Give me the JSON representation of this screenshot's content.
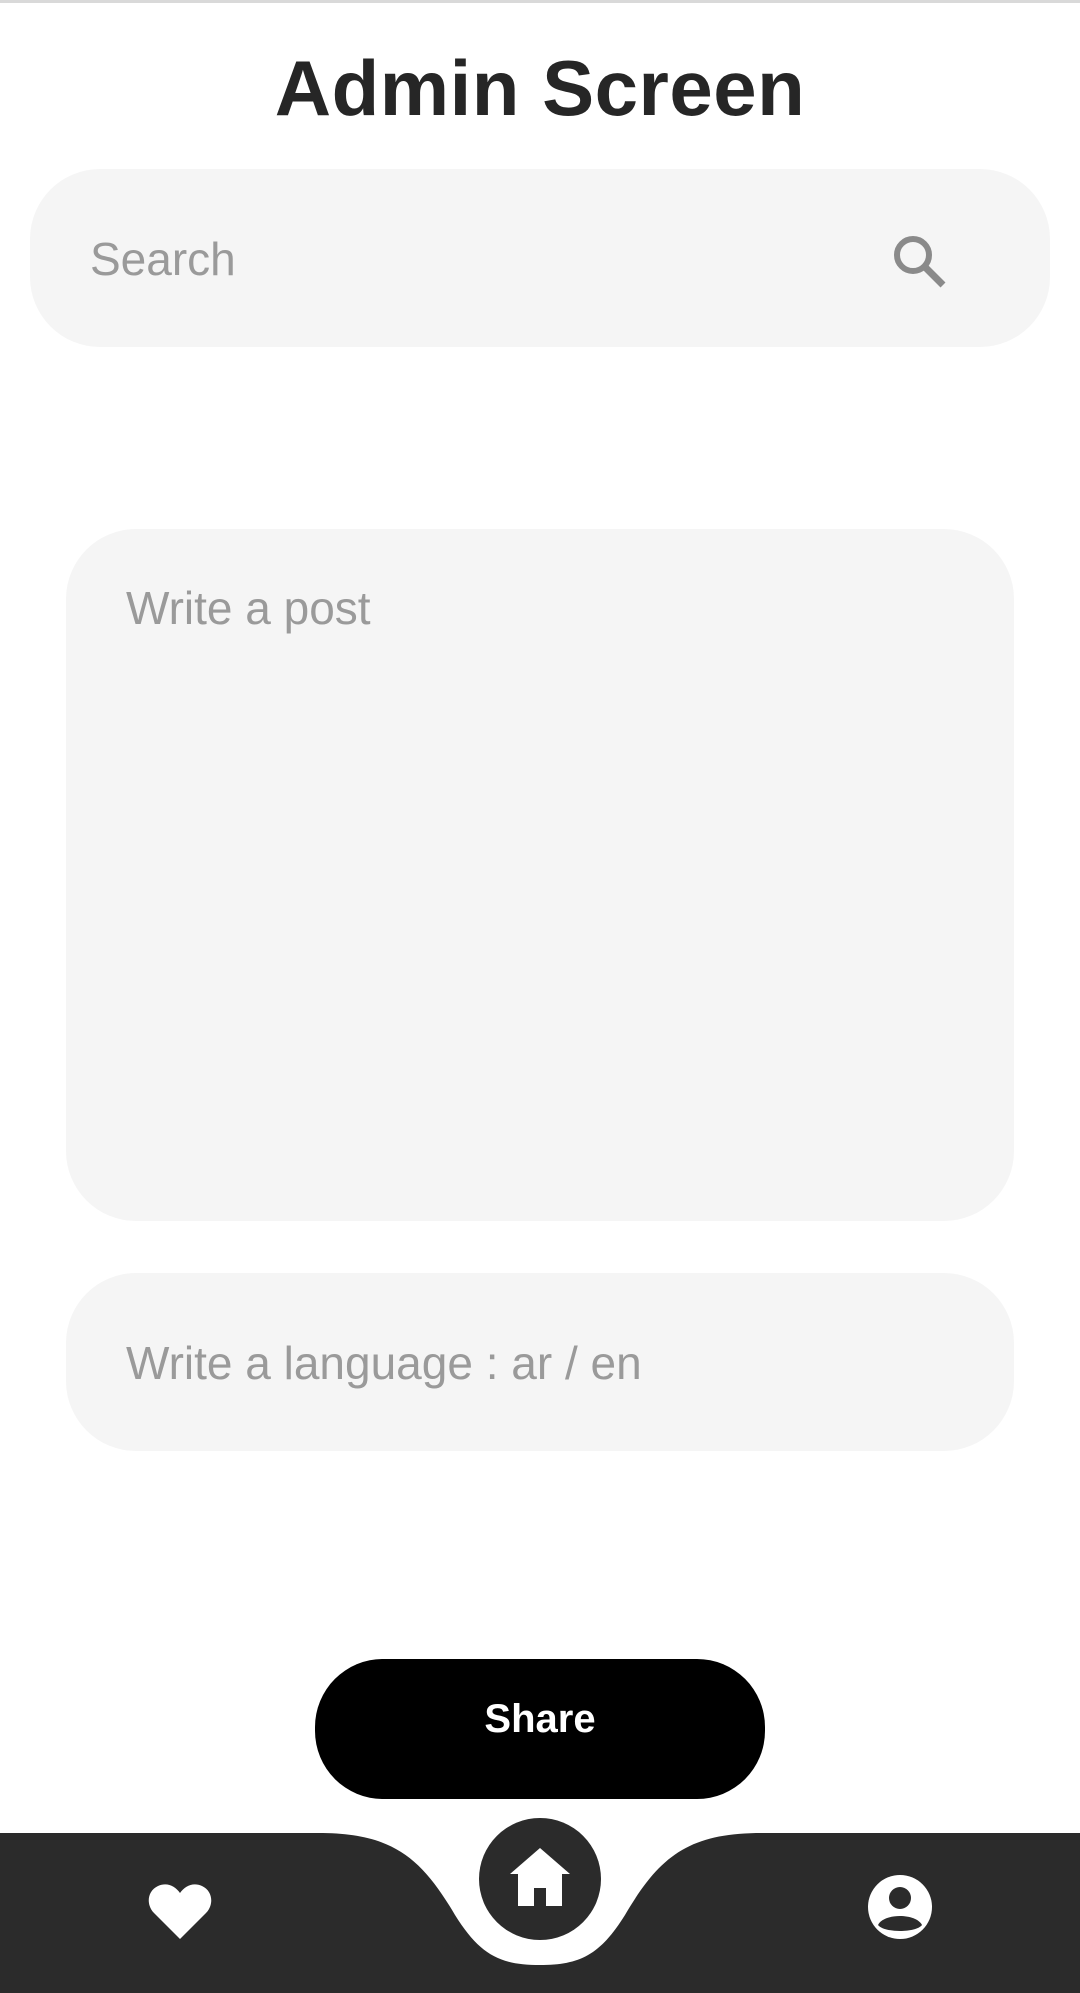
{
  "header": {
    "title": "Admin Screen"
  },
  "search": {
    "placeholder": "Search",
    "icon": "search-icon"
  },
  "post": {
    "placeholder": "Write a post"
  },
  "language": {
    "placeholder": "Write a language : ar / en"
  },
  "actions": {
    "share_label": "Share"
  },
  "bottom_nav": {
    "items": [
      {
        "icon": "heart-icon",
        "target": "favorites"
      },
      {
        "icon": "home-icon",
        "target": "home",
        "active": true
      },
      {
        "icon": "profile-icon",
        "target": "profile"
      }
    ],
    "bar_color": "#2b2b2b",
    "icon_color": "#ffffff"
  },
  "colors": {
    "field_background": "#f5f5f5",
    "placeholder": "#9a9a9a",
    "title": "#262626",
    "button": "#000000"
  }
}
